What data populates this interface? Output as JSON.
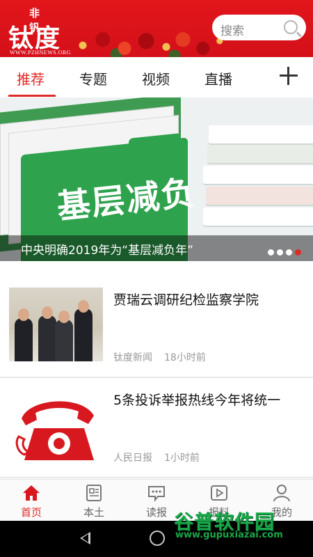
{
  "header": {
    "logo_small": "非钒",
    "logo_big": "钛度",
    "logo_url": "WWW.PZHNEWS.ORG",
    "search_placeholder": "搜索",
    "colors": {
      "brand_red": "#e2161b",
      "active_tab": "#e02a26"
    }
  },
  "tabs": [
    {
      "label": "推荐",
      "active": true
    },
    {
      "label": "专题",
      "active": false
    },
    {
      "label": "视频",
      "active": false
    },
    {
      "label": "直播",
      "active": false
    }
  ],
  "banner": {
    "image_text": "基层减负",
    "caption": "中央明确2019年为“基层减负年”",
    "slide_count": 4,
    "active_slide": 4
  },
  "news": [
    {
      "title": "贾瑞云调研纪检监察学院",
      "source": "钛度新闻",
      "time": "18小时前",
      "thumb": "photo-of-officials"
    },
    {
      "title": "5条投诉举报热线今年将统一",
      "source": "人民日报",
      "time": "1小时前",
      "thumb": "red-telephone-icon"
    }
  ],
  "bottom_nav": [
    {
      "label": "首页",
      "icon": "home-icon",
      "active": true
    },
    {
      "label": "本土",
      "icon": "newspaper-icon",
      "active": false
    },
    {
      "label": "读报",
      "icon": "chat-bubble-icon",
      "active": false
    },
    {
      "label": "报料",
      "icon": "play-video-icon",
      "active": false
    },
    {
      "label": "我的",
      "icon": "user-icon",
      "active": false
    }
  ],
  "watermark": {
    "text": "谷普软件园",
    "url": "www.gupuxiazai.com"
  }
}
